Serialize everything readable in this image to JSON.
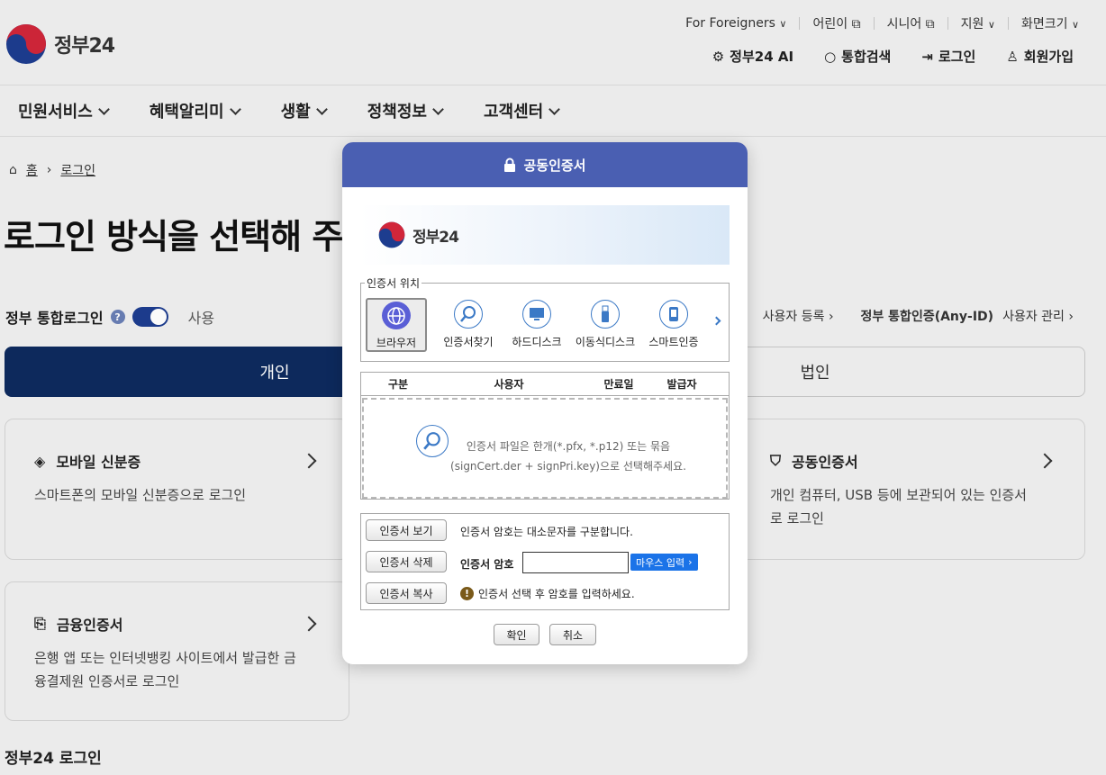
{
  "header": {
    "logo_text": "정부24",
    "util_links": [
      "For Foreigners",
      "어린이",
      "시니어",
      "지원",
      "화면크기"
    ],
    "actions": [
      "정부24 AI",
      "통합검색",
      "로그인",
      "회원가입"
    ]
  },
  "gnb": [
    "민원서비스",
    "혜택알리미",
    "생활",
    "정책정보",
    "고객센터"
  ],
  "breadcrumb": {
    "home": "홈",
    "current": "로그인"
  },
  "page_title": "로그인 방식을 선택해 주",
  "integrated_login": {
    "label": "정부 통합로그인",
    "help": "?",
    "toggle_label": "사용"
  },
  "right_links": {
    "register": "사용자 등록",
    "anyid_title": "정부 통합인증(Any-ID)",
    "manage": "사용자 관리"
  },
  "tabs": {
    "person": "개인",
    "corporate": "법인"
  },
  "cards": {
    "mobile_id": {
      "title": "모바일 신분증",
      "desc": "스마트폰의 모바일 신분증으로 로그인"
    },
    "joint_cert": {
      "title": "공동인증서",
      "desc1": "개인 컴퓨터, USB 등에 보관되어 있는 인증서",
      "desc2": "로 로그인"
    },
    "finance_cert": {
      "title": "금융인증서",
      "desc1": "은행 앱 또는 인터넷뱅킹 사이트에서 발급한 금",
      "desc2": "융결제원 인증서로 로그인"
    }
  },
  "bottom_heading": "정부24 로그인",
  "modal": {
    "title": "공동인증서",
    "banner_text": "정부24",
    "location_legend": "인증서 위치",
    "locations": [
      "브라우저",
      "인증서찾기",
      "하드디스크",
      "이동식디스크",
      "스마트인증"
    ],
    "table_headers": [
      "구분",
      "사용자",
      "만료일",
      "발급자"
    ],
    "drop_line1": "인증서 파일은 한개(*.pfx, *.p12) 또는 묶음",
    "drop_line2": "(signCert.der + signPri.key)으로 선택해주세요.",
    "btn_view": "인증서 보기",
    "btn_delete": "인증서 삭제",
    "btn_copy": "인증서 복사",
    "case_note": "인증서 암호는 대소문자를 구분합니다.",
    "pw_label": "인증서 암호",
    "pw_value": "",
    "mouse_input": "마우스 입력",
    "warn_text": "인증서 선택 후 암호를 입력하세요.",
    "ok": "확인",
    "cancel": "취소"
  }
}
